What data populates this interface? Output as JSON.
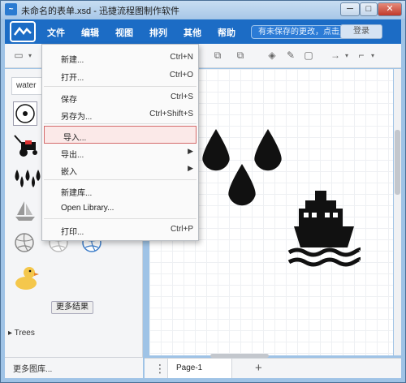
{
  "window": {
    "title": "未命名的表单.xsd - 迅捷流程图制作软件",
    "min_label": "─",
    "max_label": "□",
    "close_label": "✕"
  },
  "menubar": {
    "items": [
      {
        "label": "文件"
      },
      {
        "label": "编辑"
      },
      {
        "label": "视图"
      },
      {
        "label": "排列"
      },
      {
        "label": "其他"
      },
      {
        "label": "帮助"
      }
    ],
    "unsaved_notice": "有未保存的更改，点击此处保存",
    "login_label": "登录"
  },
  "sidebar": {
    "search_value": "water",
    "more_results_label": "更多结果",
    "trees_label": "Trees",
    "more_libraries_label": "更多图库..."
  },
  "file_menu": {
    "items": [
      {
        "label": "新建...",
        "shortcut": "Ctrl+N"
      },
      {
        "label": "打开...",
        "shortcut": "Ctrl+O"
      },
      {
        "label": "保存",
        "shortcut": "Ctrl+S"
      },
      {
        "label": "另存为...",
        "shortcut": "Ctrl+Shift+S"
      },
      {
        "label": "导入...",
        "shortcut": ""
      },
      {
        "label": "导出...",
        "shortcut": ""
      },
      {
        "label": "嵌入",
        "shortcut": ""
      },
      {
        "label": "新建库...",
        "shortcut": ""
      },
      {
        "label": "Open Library...",
        "shortcut": ""
      },
      {
        "label": "打印...",
        "shortcut": "Ctrl+P"
      }
    ]
  },
  "pages": {
    "active_tab": "Page-1",
    "add_label": "+",
    "menu_label": "⋮"
  },
  "colors": {
    "menubar": "#1c6cc5",
    "highlight_border": "#d46a6a",
    "shape_black": "#111111",
    "shape_blue": "#3d7dc9",
    "duck_yellow": "#f4c74c"
  }
}
